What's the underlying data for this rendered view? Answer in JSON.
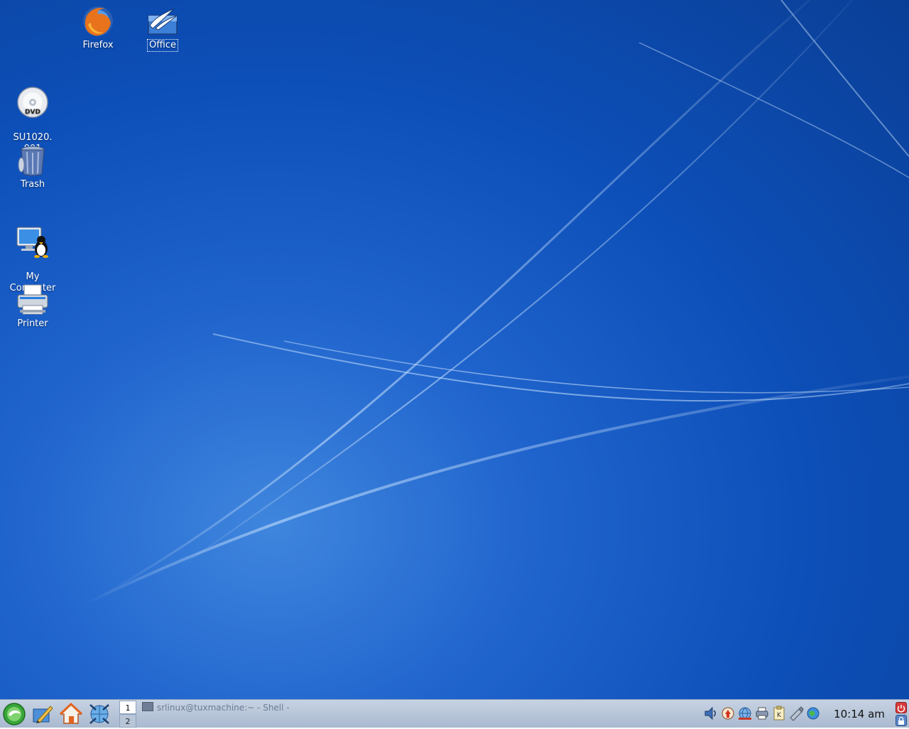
{
  "desktop": {
    "icons": [
      {
        "name": "firefox",
        "label": "Firefox"
      },
      {
        "name": "office",
        "label": "Office"
      },
      {
        "name": "dvd",
        "label": "SU1020.\n001"
      },
      {
        "name": "trash",
        "label": "Trash"
      },
      {
        "name": "my-computer",
        "label": "My\nComputer"
      },
      {
        "name": "printer",
        "label": "Printer"
      }
    ]
  },
  "taskbar": {
    "pager": {
      "desk1": "1",
      "desk2": "2"
    },
    "task_title": "srlinux@tuxmachine:~ - Shell -",
    "clock": "10:14 am",
    "launchers": [
      "menu-icon",
      "edit-icon",
      "home-icon",
      "browser-icon"
    ],
    "tray": [
      "speaker-icon",
      "update-icon",
      "network-icon",
      "printer-tray-icon",
      "klipper-icon",
      "usb-icon",
      "globe-icon"
    ]
  },
  "colors": {
    "desktop_blue": "#1f63cc",
    "taskbar": "#b9c6d8"
  }
}
